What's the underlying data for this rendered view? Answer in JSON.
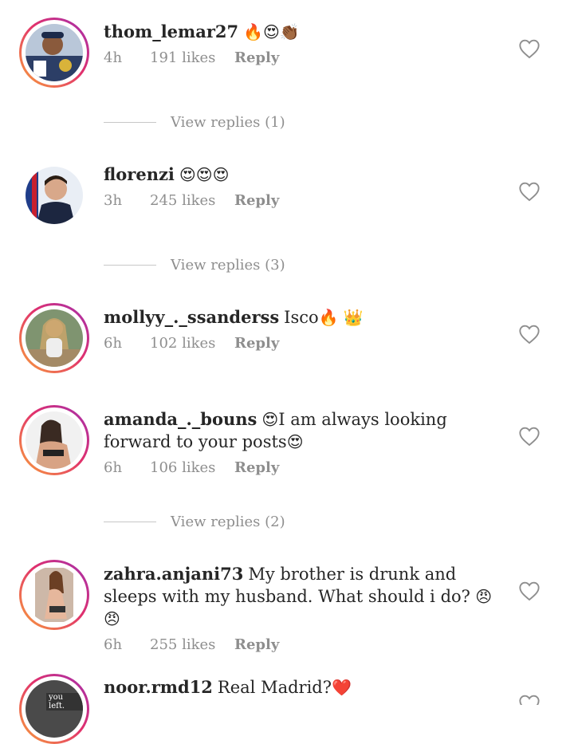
{
  "comments": [
    {
      "username": "thom_lemar27",
      "text": "",
      "emoji": "🔥😍👏🏾",
      "time": "4h",
      "likes": "191 likes",
      "reply": "Reply",
      "view_replies": "View replies (1)",
      "avatar_icon": "user-photo",
      "story_ring": true
    },
    {
      "username": "florenzi",
      "text": "",
      "emoji": "😍😍😍",
      "time": "3h",
      "likes": "245 likes",
      "reply": "Reply",
      "view_replies": "View replies (3)",
      "avatar_icon": "user-photo",
      "story_ring": false
    },
    {
      "username": "mollyy_._ssanderss",
      "text": "Isco",
      "emoji": "🔥 👑",
      "time": "6h",
      "likes": "102 likes",
      "reply": "Reply",
      "avatar_icon": "user-photo",
      "story_ring": true
    },
    {
      "username": "amanda_._bouns",
      "emoji_before": "😍",
      "text": "I am always looking forward to your posts",
      "emoji": "😍",
      "time": "6h",
      "likes": "106 likes",
      "reply": "Reply",
      "view_replies": "View replies (2)",
      "avatar_icon": "user-photo",
      "story_ring": true
    },
    {
      "username": "zahra.anjani73",
      "text": "My brother is drunk and sleeps with my husband. What should i do?",
      "emoji": " 😠😠",
      "time": "6h",
      "likes": "255 likes",
      "reply": "Reply",
      "avatar_icon": "user-photo",
      "story_ring": true
    },
    {
      "username": "noor.rmd12",
      "text": "Real Madrid?",
      "emoji": "❤️",
      "avatar_caption": "you left.",
      "avatar_icon": "user-photo",
      "story_ring": true
    }
  ],
  "colors": {
    "text": "#262626",
    "meta": "#8e8e8e",
    "ring_start": "#f9a23a",
    "ring_mid": "#e1306c",
    "ring_end": "#a02fb2"
  }
}
